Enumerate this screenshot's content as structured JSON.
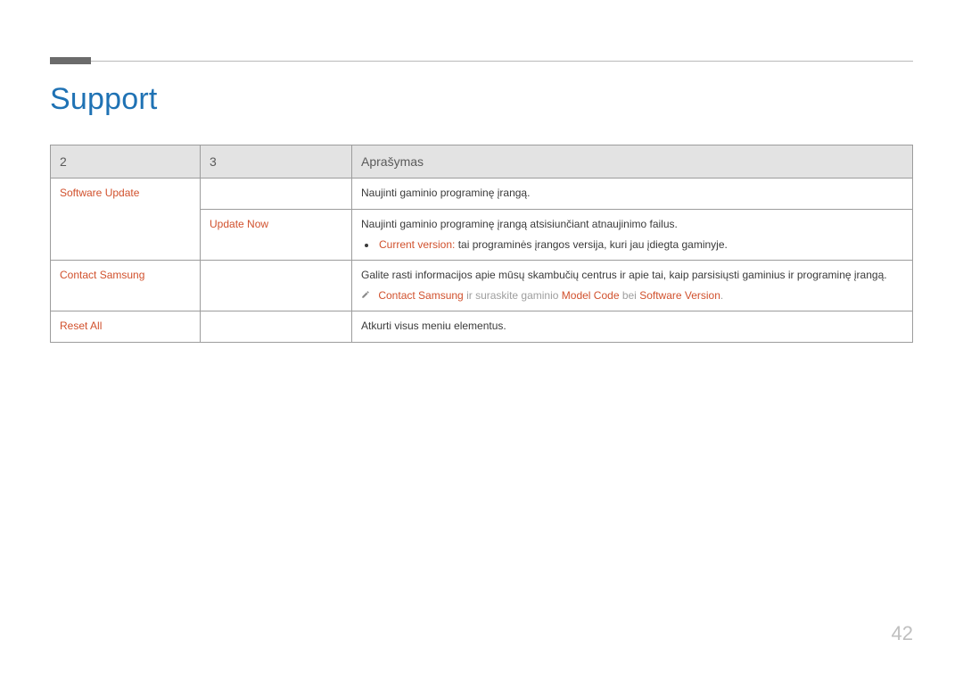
{
  "title": "Support",
  "page_number": "42",
  "table": {
    "headers": {
      "h1": "2",
      "h2": "3",
      "h3": "Aprašymas"
    },
    "rows": {
      "software_update": {
        "label": "Software Update",
        "desc": "Naujinti gaminio programinę įrangą."
      },
      "update_now": {
        "label": "Update Now",
        "desc": "Naujinti gaminio programinę įrangą atsisiunčiant atnaujinimo failus.",
        "bullet_accent": "Current version:",
        "bullet_text": " tai programinės įrangos versija, kuri jau įdiegta gaminyje."
      },
      "contact_samsung": {
        "label": "Contact Samsung",
        "desc": "Galite rasti informacijos apie mūsų skambučių centrus ir apie tai, kaip parsisiųsti gaminius ir programinę įrangą.",
        "note": {
          "a1": "Contact Samsung",
          "t1": " ir suraskite gaminio ",
          "a2": "Model Code",
          "t2": " bei ",
          "a3": "Software Version",
          "t3": "."
        }
      },
      "reset_all": {
        "label": "Reset All",
        "desc": "Atkurti visus meniu elementus."
      }
    }
  }
}
